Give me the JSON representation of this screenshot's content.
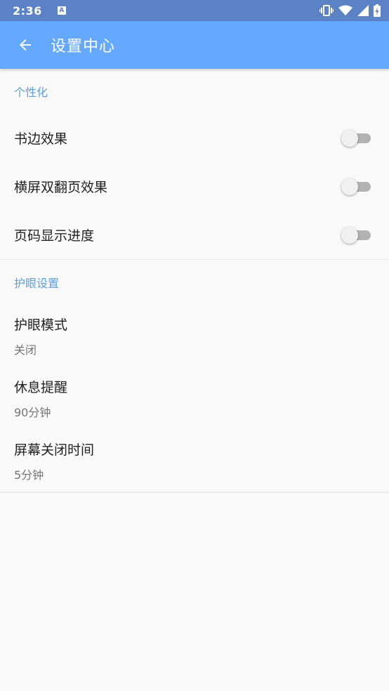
{
  "status_bar": {
    "time": "2:36",
    "notification_letter": "A",
    "icons": [
      "vibrate-icon",
      "wifi-icon",
      "signal-icon",
      "battery-icon"
    ]
  },
  "app_bar": {
    "title": "设置中心",
    "back_icon": "arrow-left-icon",
    "color": "#64a8ff"
  },
  "sections": {
    "personalization": {
      "header": "个性化",
      "items": [
        {
          "label": "书边效果",
          "enabled": false
        },
        {
          "label": "横屏双翻页效果",
          "enabled": false
        },
        {
          "label": "页码显示进度",
          "enabled": false
        }
      ]
    },
    "eye_care": {
      "header": "护眼设置",
      "items": [
        {
          "label": "护眼模式",
          "value": "关闭"
        },
        {
          "label": "休息提醒",
          "value": "90分钟"
        },
        {
          "label": "屏幕关闭时间",
          "value": "5分钟"
        }
      ]
    }
  },
  "colors": {
    "status_bar": "#5b82c4",
    "section_header": "#5a9fe0",
    "background": "#fafafa"
  }
}
